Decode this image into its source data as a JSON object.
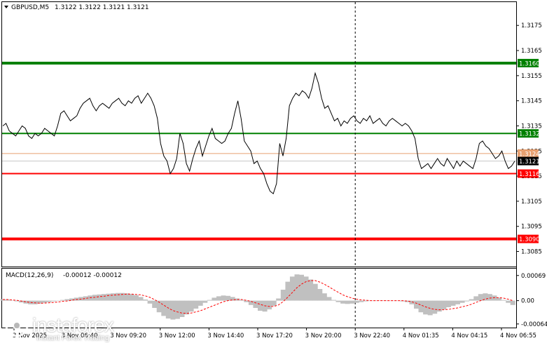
{
  "header": {
    "symbol": "GBPUSD,M5",
    "ohlc": "1.3122 1.3122 1.3121 1.3121"
  },
  "macd_header": {
    "label": "MACD(12,26,9)",
    "values": "-0.00012 -0.00012"
  },
  "logo": {
    "brand": "instaforex",
    "tagline": "Instant Forex Trading"
  },
  "colors": {
    "green_line": "#008000",
    "red_line": "#ff0000",
    "orange_line": "#e8a070",
    "price_line": "#000000",
    "histogram": "#c0c0c0",
    "signal": "#ff0000"
  },
  "chart_data": [
    {
      "type": "line",
      "title": "GBPUSD,M5",
      "ylim": [
        1.3079,
        1.3184
      ],
      "y_ticks": [
        "1.3175",
        "1.3165",
        "1.3155",
        "1.3145",
        "1.3135",
        "1.3125",
        "1.3115",
        "1.3105",
        "1.3095",
        "1.3085"
      ],
      "x_ticks": [
        "3 Nov 2025",
        "3 Nov 06:40",
        "3 Nov 09:20",
        "3 Nov 12:00",
        "3 Nov 14:40",
        "3 Nov 17:20",
        "3 Nov 20:00",
        "3 Nov 22:40",
        "4 Nov 01:35",
        "4 Nov 04:15",
        "4 Nov 06:55"
      ],
      "levels": [
        {
          "value": 1.316,
          "label": "1.3160",
          "color": "green",
          "style": "thick"
        },
        {
          "value": 1.3132,
          "label": "1.3132",
          "color": "green",
          "style": "normal"
        },
        {
          "value": 1.3124,
          "label": "1.3124",
          "color": "orange",
          "style": "thin"
        },
        {
          "value": 1.3116,
          "label": "1.3116",
          "color": "red",
          "style": "normal"
        },
        {
          "value": 1.309,
          "label": "1.3090",
          "color": "red",
          "style": "thick"
        }
      ],
      "current_price": {
        "value": 1.3121,
        "label": "1.3121"
      },
      "separator_at": "3 Nov 22:40",
      "series": [
        {
          "values": [
            1.3135,
            1.3136,
            1.3133,
            1.3132,
            1.3131,
            1.3133,
            1.3135,
            1.3134,
            1.3131,
            1.313,
            1.3132,
            1.3131,
            1.3132,
            1.3134,
            1.3133,
            1.3132,
            1.3131,
            1.3135,
            1.314,
            1.3141,
            1.3139,
            1.3137,
            1.3138,
            1.3139,
            1.3142,
            1.3144,
            1.3145,
            1.3146,
            1.3143,
            1.3141,
            1.3143,
            1.3144,
            1.3143,
            1.3142,
            1.3144,
            1.3145,
            1.3146,
            1.3144,
            1.3143,
            1.3145,
            1.3144,
            1.3146,
            1.3147,
            1.3144,
            1.3146,
            1.3148,
            1.3146,
            1.3143,
            1.3138,
            1.3128,
            1.3123,
            1.3121,
            1.3116,
            1.3118,
            1.3122,
            1.3132,
            1.3128,
            1.312,
            1.3117,
            1.3122,
            1.3126,
            1.3129,
            1.3123,
            1.3127,
            1.3131,
            1.3134,
            1.313,
            1.3129,
            1.3128,
            1.3129,
            1.3132,
            1.3134,
            1.314,
            1.3145,
            1.3138,
            1.3129,
            1.3127,
            1.3125,
            1.312,
            1.3121,
            1.3118,
            1.3116,
            1.3112,
            1.3109,
            1.3108,
            1.3112,
            1.3128,
            1.3123,
            1.313,
            1.3143,
            1.3146,
            1.3148,
            1.3147,
            1.3149,
            1.3148,
            1.3146,
            1.315,
            1.3156,
            1.3152,
            1.3146,
            1.3142,
            1.3143,
            1.314,
            1.3137,
            1.3138,
            1.3135,
            1.3137,
            1.3136,
            1.3138,
            1.3139,
            1.3137,
            1.3136,
            1.3138,
            1.3137,
            1.3139,
            1.3136,
            1.3137,
            1.3138,
            1.3136,
            1.3135,
            1.3137,
            1.3138,
            1.3137,
            1.3136,
            1.3135,
            1.3136,
            1.3135,
            1.3133,
            1.313,
            1.3122,
            1.3118,
            1.3119,
            1.312,
            1.3118,
            1.312,
            1.3122,
            1.312,
            1.3119,
            1.3122,
            1.312,
            1.3118,
            1.3121,
            1.3119,
            1.3121,
            1.312,
            1.3119,
            1.3118,
            1.3122,
            1.3128,
            1.3129,
            1.3127,
            1.3126,
            1.3124,
            1.3122,
            1.3123,
            1.3125,
            1.3121,
            1.3118,
            1.3119,
            1.3121
          ]
        }
      ]
    },
    {
      "type": "bar",
      "title": "MACD(12,26,9)",
      "ylim": [
        -0.00072,
        0.00082
      ],
      "y_ticks": [
        "0.00069",
        "0.00",
        "-0.00064"
      ],
      "series": [
        {
          "name": "MACD",
          "values": [
            4e-05,
            3e-05,
            1e-05,
            -2e-05,
            -5e-05,
            -8e-05,
            -0.0001,
            -0.0001,
            -8e-05,
            -6e-05,
            -4e-05,
            -2e-05,
            0.0,
            2e-05,
            4e-05,
            6e-05,
            8e-05,
            0.0001,
            0.00012,
            0.00014,
            0.00016,
            0.00017,
            0.00018,
            0.00019,
            0.0002,
            0.00021,
            0.00021,
            0.0002,
            0.00018,
            0.00015,
            0.0001,
            3e-05,
            -8e-05,
            -0.0002,
            -0.00032,
            -0.00042,
            -0.00049,
            -0.00052,
            -0.0005,
            -0.00045,
            -0.00038,
            -0.0003,
            -0.00022,
            -0.00014,
            -6e-05,
            2e-05,
            8e-05,
            0.00012,
            0.00014,
            0.00013,
            0.0001,
            6e-05,
            2e-05,
            -4e-05,
            -0.00012,
            -0.0002,
            -0.00028,
            -0.0003,
            -0.00024,
            -0.00014,
            6e-05,
            0.0003,
            0.00052,
            0.00066,
            0.00072,
            0.00071,
            0.00066,
            0.00058,
            0.00046,
            0.00032,
            0.0002,
            0.0001,
            2e-05,
            -4e-05,
            -8e-05,
            -9e-05,
            -8e-05,
            -6e-05,
            -4e-05,
            -2e-05,
            -1e-05,
            0.0,
            1e-05,
            1e-05,
            0.0,
            0.0,
            -1e-05,
            -2e-05,
            -4e-05,
            -0.0001,
            -0.00022,
            -0.00032,
            -0.00038,
            -0.0004,
            -0.00036,
            -0.0003,
            -0.00024,
            -0.00018,
            -0.00014,
            -0.0001,
            -6e-05,
            -2e-05,
            4e-05,
            0.00012,
            0.00018,
            0.0002,
            0.00018,
            0.00014,
            8e-05,
            2e-05,
            -6e-05,
            -0.00012
          ]
        },
        {
          "name": "Signal",
          "values": [
            3e-05,
            3e-05,
            2e-05,
            1e-05,
            -1e-05,
            -3e-05,
            -5e-05,
            -6e-05,
            -7e-05,
            -7e-05,
            -6e-05,
            -5e-05,
            -4e-05,
            -2e-05,
            -1e-05,
            1e-05,
            3e-05,
            4e-05,
            6e-05,
            8e-05,
            9e-05,
            0.00011,
            0.00012,
            0.00014,
            0.00015,
            0.00016,
            0.00017,
            0.00018,
            0.00018,
            0.00017,
            0.00016,
            0.00013,
            9e-05,
            3e-05,
            -4e-05,
            -0.00012,
            -0.0002,
            -0.00027,
            -0.00031,
            -0.00034,
            -0.00035,
            -0.00034,
            -0.00031,
            -0.00028,
            -0.00023,
            -0.00018,
            -0.00013,
            -8e-05,
            -3e-05,
            0.0,
            2e-05,
            3e-05,
            3e-05,
            1e-05,
            -2e-05,
            -6e-05,
            -0.0001,
            -0.00014,
            -0.00016,
            -0.00016,
            -0.00012,
            -3e-05,
            9e-05,
            0.00022,
            0.00035,
            0.00045,
            0.00052,
            0.00055,
            0.00055,
            0.00051,
            0.00045,
            0.00038,
            0.0003,
            0.00023,
            0.00016,
            0.00011,
            7e-05,
            4e-05,
            2e-05,
            1e-05,
            0.0,
            0.0,
            0.0,
            0.0,
            0.0,
            0.0,
            0.0,
            0.0,
            -1e-05,
            -3e-05,
            -7e-05,
            -0.00012,
            -0.00017,
            -0.00021,
            -0.00024,
            -0.00025,
            -0.00025,
            -0.00024,
            -0.00022,
            -0.0002,
            -0.00017,
            -0.00014,
            -0.0001,
            -5e-05,
            0.0,
            4e-05,
            7e-05,
            8e-05,
            8e-05,
            7e-05,
            4e-05,
            0.0
          ]
        }
      ]
    }
  ]
}
